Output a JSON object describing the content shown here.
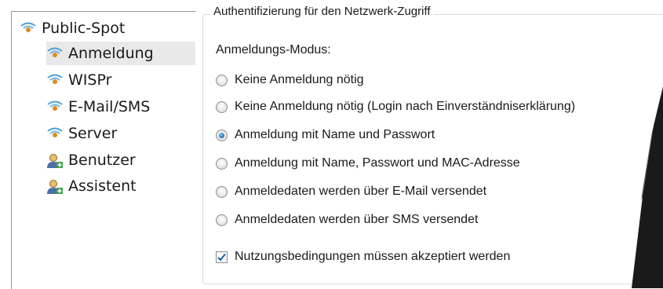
{
  "tree": {
    "root": {
      "label": "Public-Spot",
      "icon": "wifi-icon"
    },
    "items": [
      {
        "label": "Anmeldung",
        "icon": "wifi-icon",
        "selected": true
      },
      {
        "label": "WISPr",
        "icon": "wifi-icon"
      },
      {
        "label": "E-Mail/SMS",
        "icon": "wifi-icon"
      },
      {
        "label": "Server",
        "icon": "wifi-icon"
      },
      {
        "label": "Benutzer",
        "icon": "user-add-icon"
      },
      {
        "label": "Assistent",
        "icon": "user-add-icon"
      }
    ]
  },
  "group": {
    "title": "Authentifizierung für den Netzwerk-Zugriff",
    "mode_label": "Anmeldungs-Modus:",
    "options": [
      {
        "label": "Keine Anmeldung nötig",
        "selected": false
      },
      {
        "label": "Keine Anmeldung nötig (Login nach Einverständniserklärung)",
        "selected": false
      },
      {
        "label": "Anmeldung mit Name und Passwort",
        "selected": true
      },
      {
        "label": "Anmeldung mit Name, Passwort und MAC-Adresse",
        "selected": false
      },
      {
        "label": "Anmeldedaten werden über E-Mail versendet",
        "selected": false
      },
      {
        "label": "Anmeldedaten werden über SMS versendet",
        "selected": false
      }
    ],
    "terms": {
      "label": "Nutzungsbedingungen müssen akzeptiert werden",
      "checked": true
    }
  },
  "colors": {
    "accent": "#2a7fc9",
    "selection": "#e9e9e9",
    "border": "#d5dfe5"
  }
}
